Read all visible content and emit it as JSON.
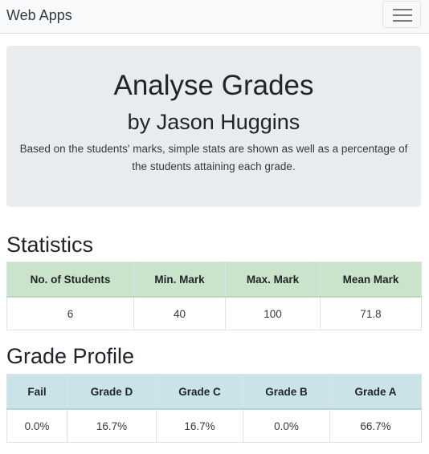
{
  "navbar": {
    "brand": "Web Apps",
    "toggler_icon": "hamburger-menu-icon"
  },
  "jumbotron": {
    "title": "Analyse Grades",
    "subtitle": "by Jason Huggins",
    "description": "Based on the students' marks, simple stats are shown as well as a percentage of the students attaining each grade."
  },
  "statistics": {
    "title": "Statistics",
    "headers": [
      "No. of Students",
      "Min. Mark",
      "Max. Mark",
      "Mean Mark"
    ],
    "values": [
      "6",
      "40",
      "100",
      "71.8"
    ],
    "header_color": "#c9e4ca"
  },
  "grade_profile": {
    "title": "Grade Profile",
    "headers": [
      "Fail",
      "Grade D",
      "Grade C",
      "Grade B",
      "Grade A"
    ],
    "values": [
      "0.0%",
      "16.7%",
      "16.7%",
      "0.0%",
      "66.7%"
    ],
    "header_color": "#c9e3e8"
  }
}
